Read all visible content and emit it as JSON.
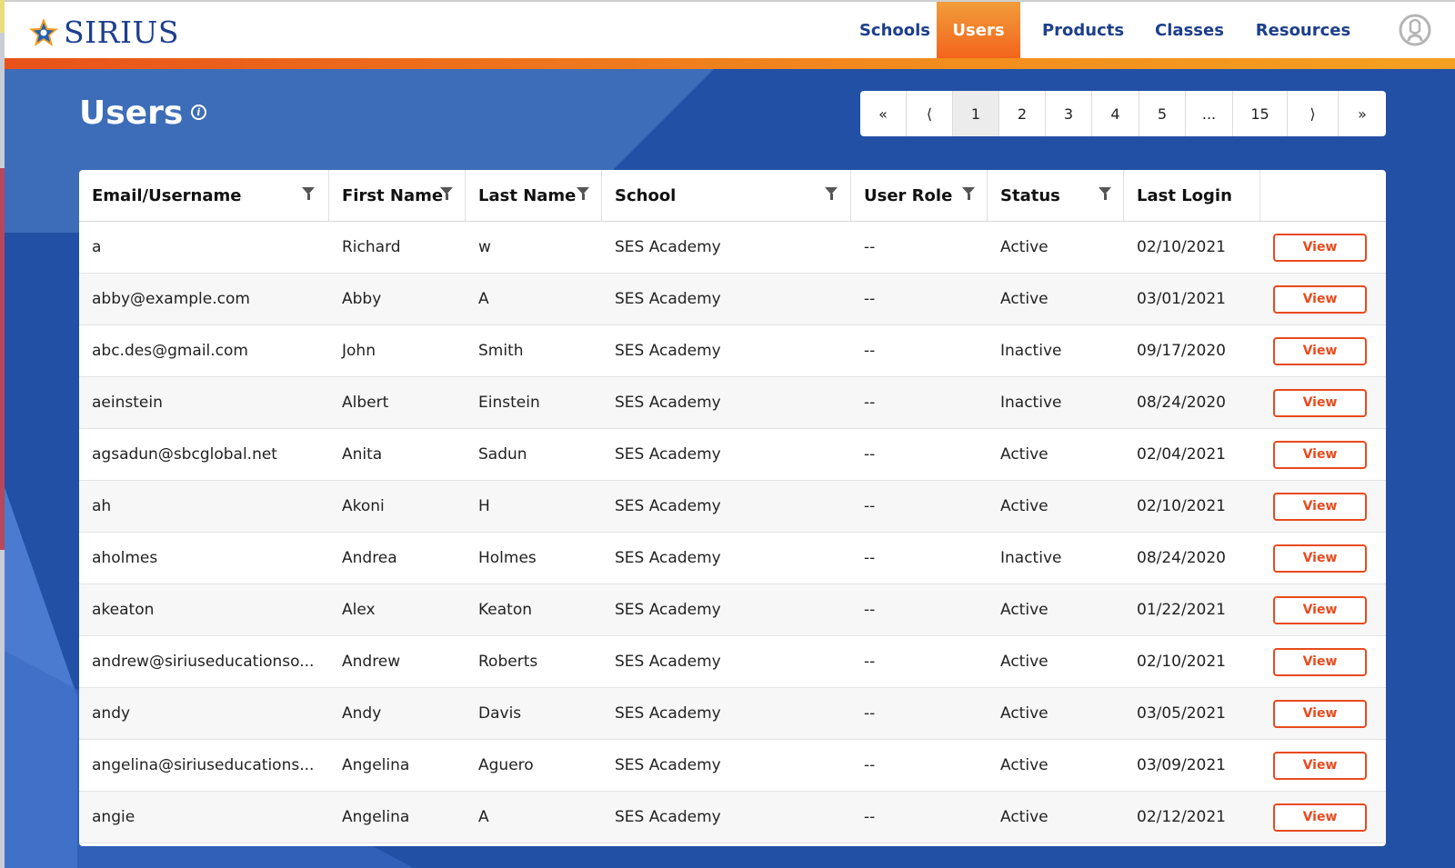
{
  "brand": {
    "name": "SIRIUS"
  },
  "nav": [
    {
      "label": "Schools",
      "active": false
    },
    {
      "label": "Users",
      "active": true
    },
    {
      "label": "Products",
      "active": false
    },
    {
      "label": "Classes",
      "active": false
    },
    {
      "label": "Resources",
      "active": false
    }
  ],
  "page": {
    "title": "Users",
    "info_glyph": "i"
  },
  "pagination": [
    "«",
    "⟨",
    "1",
    "2",
    "3",
    "4",
    "5",
    "...",
    "15",
    "⟩",
    "»"
  ],
  "pagination_current": "1",
  "table": {
    "columns": [
      "Email/Username",
      "First Name",
      "Last Name",
      "School",
      "User Role",
      "Status",
      "Last Login",
      ""
    ],
    "filterable": [
      true,
      true,
      true,
      true,
      true,
      true,
      false,
      false
    ],
    "action_label": "View",
    "rows": [
      [
        "a",
        "Richard",
        "w",
        "SES Academy",
        "--",
        "Active",
        "02/10/2021"
      ],
      [
        "abby@example.com",
        "Abby",
        "A",
        "SES Academy",
        "--",
        "Active",
        "03/01/2021"
      ],
      [
        "abc.des@gmail.com",
        "John",
        "Smith",
        "SES Academy",
        "--",
        "Inactive",
        "09/17/2020"
      ],
      [
        "aeinstein",
        "Albert",
        "Einstein",
        "SES Academy",
        "--",
        "Inactive",
        "08/24/2020"
      ],
      [
        "agsadun@sbcglobal.net",
        "Anita",
        "Sadun",
        "SES Academy",
        "--",
        "Active",
        "02/04/2021"
      ],
      [
        "ah",
        "Akoni",
        "H",
        "SES Academy",
        "--",
        "Active",
        "02/10/2021"
      ],
      [
        "aholmes",
        "Andrea",
        "Holmes",
        "SES Academy",
        "--",
        "Inactive",
        "08/24/2020"
      ],
      [
        "akeaton",
        "Alex",
        "Keaton",
        "SES Academy",
        "--",
        "Active",
        "01/22/2021"
      ],
      [
        "andrew@siriuseducationso...",
        "Andrew",
        "Roberts",
        "SES Academy",
        "--",
        "Active",
        "02/10/2021"
      ],
      [
        "andy",
        "Andy",
        "Davis",
        "SES Academy",
        "--",
        "Active",
        "03/05/2021"
      ],
      [
        "angelina@siriuseducations...",
        "Angelina",
        "Aguero",
        "SES Academy",
        "--",
        "Active",
        "03/09/2021"
      ],
      [
        "angie",
        "Angelina",
        "A",
        "SES Academy",
        "--",
        "Active",
        "02/12/2021"
      ]
    ]
  },
  "colors": {
    "brand_blue": "#1d3f8b",
    "accent_orange": "#e84a1d",
    "background_blue": "#2250a4"
  },
  "icons": {
    "logo": "star-icon",
    "info": "info-icon",
    "filter": "filter-icon",
    "user": "user-avatar-icon"
  }
}
